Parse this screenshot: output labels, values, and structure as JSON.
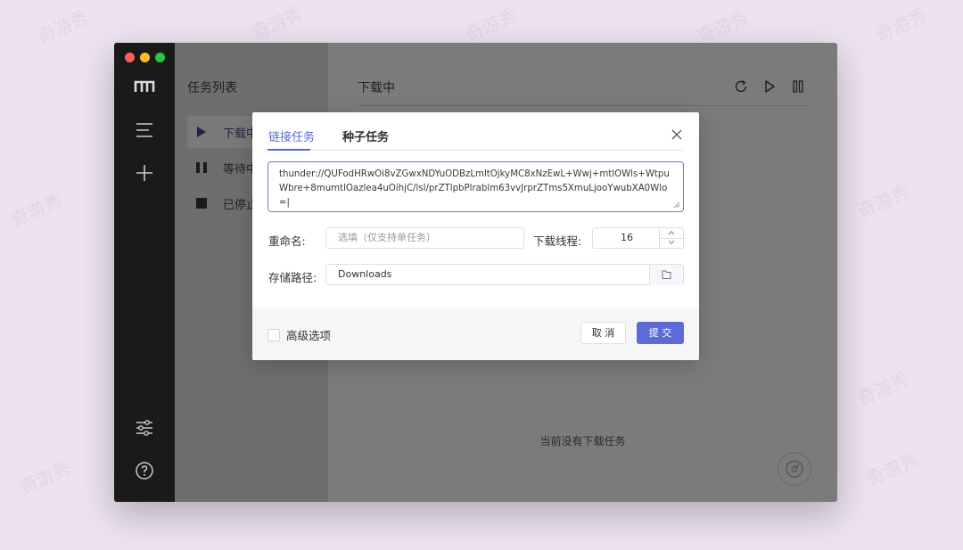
{
  "background": {
    "watermark_text": "奇游秀",
    "color": "#ece2f0"
  },
  "sidebar": {
    "logo_icon": "motrix-logo-icon",
    "icons": [
      "menu-icon",
      "plus-icon",
      "settings-sliders-icon",
      "help-icon"
    ]
  },
  "task_list": {
    "title": "任务列表",
    "items": [
      {
        "label": "下载中",
        "icon": "play-icon",
        "active": true
      },
      {
        "label": "等待中",
        "icon": "pause-icon",
        "active": false
      },
      {
        "label": "已停止",
        "icon": "stop-icon",
        "active": false
      }
    ]
  },
  "main": {
    "title": "下载中",
    "toolbar": [
      "refresh-icon",
      "resume-all-icon",
      "pause-all-icon"
    ],
    "empty_text": "当前没有下载任务",
    "speed_icon": "speedometer-icon"
  },
  "dialog": {
    "tabs": [
      {
        "label": "链接任务",
        "active": true
      },
      {
        "label": "种子任务",
        "active": false
      }
    ],
    "url_value": "thunder://QUFodHRwOi8vZGwxNDYuODBzLmltOjkyMC8xNzEwL+Wwj+mtlOWls+WtpuWbre+8mumtlOazlea4uOihjC/lsl/prZTlpbPlrablm63vvJrprZTms5XmuLjooYwubXA0Wlo=|",
    "rename": {
      "label": "重命名:",
      "placeholder": "选填（仅支持单任务）"
    },
    "threads": {
      "label": "下载线程:",
      "value": "16"
    },
    "path": {
      "label": "存储路径:",
      "value": "Downloads"
    },
    "advanced_label": "高级选项",
    "cancel_label": "取 消",
    "submit_label": "提 交",
    "accent_color": "#5c6bd6"
  }
}
